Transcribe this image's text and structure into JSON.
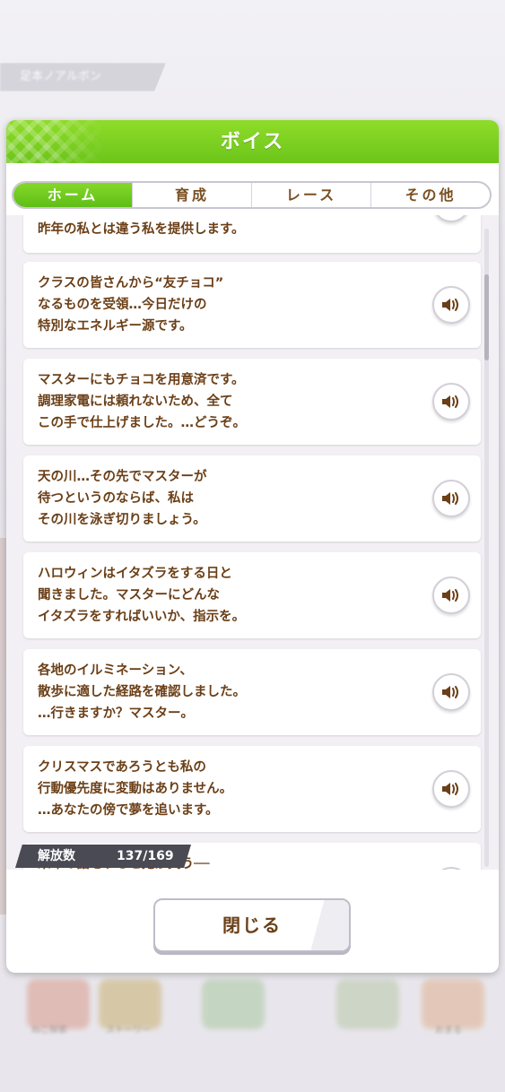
{
  "background": {
    "tag_text": "足本ノアルボン",
    "bottom_labels": [
      "ねこ探索",
      "ストーリー",
      "",
      "",
      "おまる"
    ]
  },
  "dialog": {
    "title": "ボイス",
    "tabs": [
      {
        "label": "ホーム",
        "active": true
      },
      {
        "label": "育成",
        "active": false
      },
      {
        "label": "レース",
        "active": false
      },
      {
        "label": "その他",
        "active": false
      }
    ],
    "voice_lines": [
      {
        "text": "昨年の私とは違う私を提供します。"
      },
      {
        "text": "クラスの皆さんから“友チョコ”\nなるものを受領…今日だけの\n特別なエネルギー源です。"
      },
      {
        "text": "マスターにもチョコを用意済です。\n調理家電には頼れないため、全て\nこの手で仕上げました。…どうぞ。"
      },
      {
        "text": "天の川…その先でマスターが\n待つというのならば、私は\nその川を泳ぎ切りましょう。"
      },
      {
        "text": "ハロウィンはイタズラをする日と\n聞きました。マスターにどんな\nイタズラをすればいいか、指示を。"
      },
      {
        "text": "各地のイルミネーション、\n散歩に適した経路を確認しました。\n…行きますか？マスター。"
      },
      {
        "text": "クリスマスであろうとも私の\n行動優先度に変動はありません。\n…あなたの傍で夢を追います。"
      },
      {
        "text": "来年の話をすると鬼が笑う──"
      }
    ],
    "unlock_label": "解放数",
    "unlock_count": "137/169",
    "close_label": "閉じる"
  },
  "colors": {
    "header_green": "#7ad122",
    "text_brown": "#6b3f17",
    "list_bg": "#f2f0f4"
  }
}
